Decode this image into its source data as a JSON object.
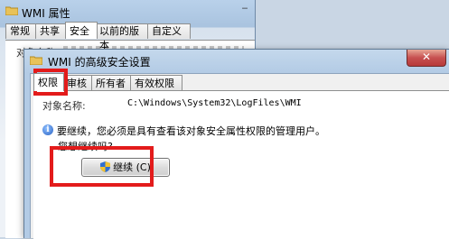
{
  "back_window": {
    "title": "WMI 属性",
    "tabs": [
      "常规",
      "共享",
      "安全",
      "以前的版本",
      "自定义"
    ],
    "active_tab": 2,
    "partial_text": "对象名称"
  },
  "front_window": {
    "title": "WMI 的高级安全设置",
    "close_label": "✕",
    "tabs": [
      "权限",
      "审核",
      "所有者",
      "有效权限"
    ],
    "active_tab": 0,
    "object_name_label": "对象名称:",
    "object_name_value": "C:\\Windows\\System32\\LogFiles\\WMI",
    "info_text": "要继续，您必须是具有查看该对象安全属性权限的管理用户。",
    "question_text": "您想继续吗?",
    "continue_button_label": "继续 (C)"
  },
  "colors": {
    "annotation_red": "#e31b1b",
    "close_button": "#c75050"
  },
  "icons": {
    "folder": "folder-icon",
    "info": "info-icon",
    "shield": "uac-shield-icon"
  }
}
